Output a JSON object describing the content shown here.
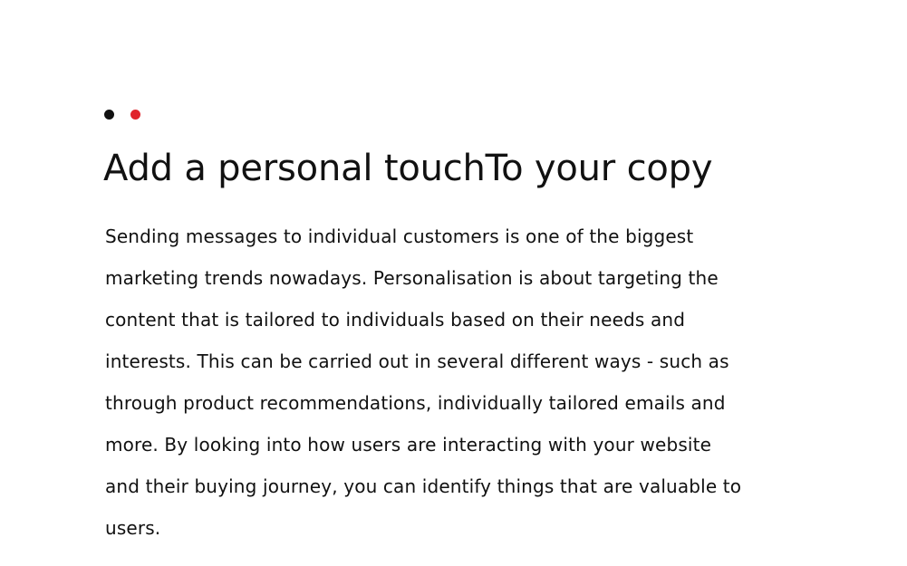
{
  "colors": {
    "text": "#111111",
    "accent": "#e0242b",
    "background": "#ffffff"
  },
  "pagination": {
    "dots": [
      {
        "name": "dot-1",
        "color": "#111111"
      },
      {
        "name": "dot-2",
        "color": "#e0242b"
      }
    ]
  },
  "article": {
    "title": "Add a personal touchTo your copy",
    "lines": [
      "Sending messages to individual customers is one of the biggest",
      "marketing trends nowadays. Personalisation is about targeting the",
      "content that is tailored to individuals based on their needs and",
      "interests. This can be carried out in several different ways - such as",
      "through product recommendations, individually tailored emails and",
      "more.  By looking into how users are interacting with your website",
      "and their buying journey, you can identify things that are valuable to",
      "users."
    ]
  }
}
